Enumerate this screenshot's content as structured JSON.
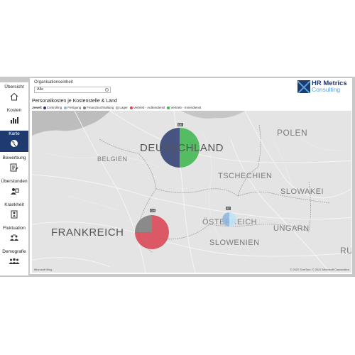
{
  "sidebar": {
    "items": [
      {
        "label": "Übersicht",
        "icon": "house-icon",
        "active": false
      },
      {
        "label": "Kosten",
        "icon": "cost-chart-icon",
        "active": false
      },
      {
        "label": "Karte",
        "icon": "globe-icon",
        "active": true
      },
      {
        "label": "Bewerbung",
        "icon": "application-icon",
        "active": false
      },
      {
        "label": "Überstunden",
        "icon": "overtime-icon",
        "active": false
      },
      {
        "label": "Krankheit",
        "icon": "sick-icon",
        "active": false
      },
      {
        "label": "Fluktuation",
        "icon": "turnover-icon",
        "active": false
      },
      {
        "label": "Demografie",
        "icon": "people-icon",
        "active": false
      }
    ]
  },
  "filter": {
    "title": "Organisationseinheit",
    "value": "Alle"
  },
  "logo": {
    "line1": "HR Metrics",
    "line2": "Consulting"
  },
  "chart": {
    "title": "Personalkosten je Kostenstelle & Land",
    "legend_title": "Jewelt",
    "legend": [
      {
        "label": "Controlling",
        "color": "#2b3a6e"
      },
      {
        "label": "Fertigung",
        "color": "#8fb4e0"
      },
      {
        "label": "Finanzbuchhaltung",
        "color": "#7a7a7a"
      },
      {
        "label": "Lager",
        "color": "#bfe3f5"
      },
      {
        "label": "Vertrieb - Außendienst",
        "color": "#d94050"
      },
      {
        "label": "Vertrieb - Innendienst",
        "color": "#3bb54a"
      }
    ]
  },
  "map": {
    "countries": {
      "deutschland": "DEUTSCHLAND",
      "polen": "POLEN",
      "belgien": "BELGIEN",
      "tschechien": "TSCHECHIEN",
      "slowakei": "SLOWAKEI",
      "frankreich": "FRANKREICH",
      "oesterreich": "ÖSTERREICH",
      "ungarn": "UNGARN",
      "slowenien": "SLOWENIEN",
      "ru": "RU"
    },
    "tags": {
      "de": "DE",
      "ch": "CH",
      "at": "AT"
    },
    "attribution": "© 2022 TomTom, © 2022 Microsoft Corporation",
    "attribution_left": "Microsoft Bing"
  },
  "chart_data": {
    "type": "pie",
    "markers": [
      {
        "country": "DE",
        "slices": [
          {
            "series": "Controlling",
            "share": 0.5
          },
          {
            "series": "Vertrieb - Innendienst",
            "share": 0.5
          }
        ]
      },
      {
        "country": "CH",
        "slices": [
          {
            "series": "Vertrieb - Außendienst",
            "share": 0.75
          },
          {
            "series": "Finanzbuchhaltung",
            "share": 0.25
          }
        ]
      },
      {
        "country": "AT",
        "slices": [
          {
            "series": "Fertigung",
            "share": 0.5
          },
          {
            "series": "Lager",
            "share": 0.5
          }
        ]
      }
    ]
  }
}
